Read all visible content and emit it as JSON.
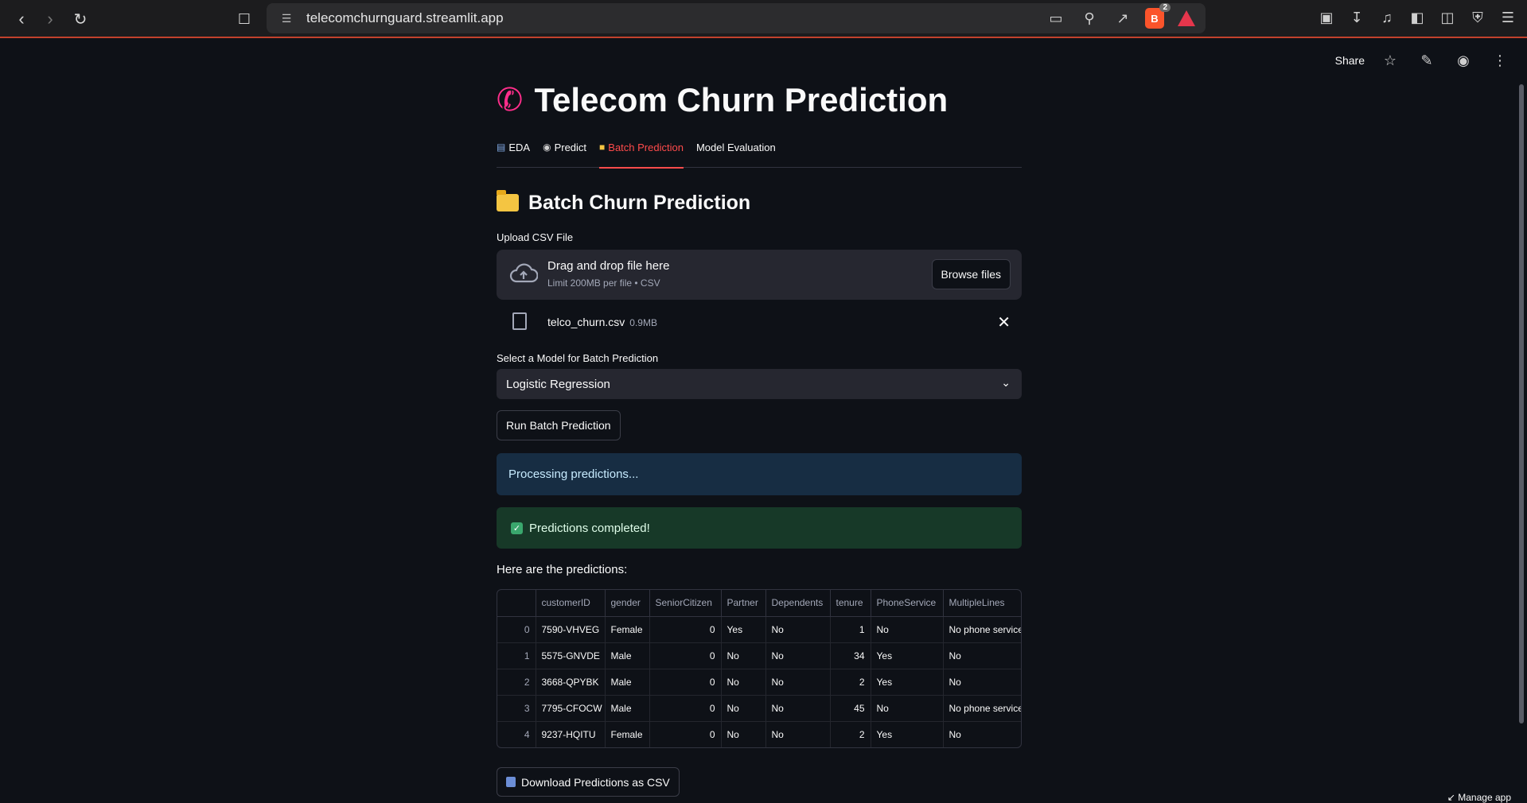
{
  "browser": {
    "url": "telecomchurnguard.streamlit.app",
    "brave_badge": "2"
  },
  "toolbar": {
    "share_label": "Share"
  },
  "app": {
    "title": "Telecom Churn Prediction",
    "tabs": [
      {
        "label": "EDA",
        "icon": "chart-icon"
      },
      {
        "label": "Predict",
        "icon": "eye-icon"
      },
      {
        "label": "Batch Prediction",
        "icon": "folder-icon"
      },
      {
        "label": "Model Evaluation",
        "icon": ""
      }
    ]
  },
  "batch": {
    "heading": "Batch Churn Prediction",
    "upload_label": "Upload CSV File",
    "dropzone_main": "Drag and drop file here",
    "dropzone_sub": "Limit 200MB per file • CSV",
    "browse_label": "Browse files",
    "file_name": "telco_churn.csv",
    "file_size": "0.9MB",
    "model_label": "Select a Model for Batch Prediction",
    "model_value": "Logistic Regression",
    "run_label": "Run Batch Prediction",
    "info_text": "Processing predictions...",
    "success_text": "Predictions completed!",
    "results_text": "Here are the predictions:",
    "download_label": "Download Predictions as CSV",
    "manage_label": "Manage app"
  },
  "table": {
    "columns": [
      "",
      "customerID",
      "gender",
      "SeniorCitizen",
      "Partner",
      "Dependents",
      "tenure",
      "PhoneService",
      "MultipleLines"
    ],
    "rows": [
      [
        "0",
        "7590-VHVEG",
        "Female",
        "0",
        "Yes",
        "No",
        "1",
        "No",
        "No phone service"
      ],
      [
        "1",
        "5575-GNVDE",
        "Male",
        "0",
        "No",
        "No",
        "34",
        "Yes",
        "No"
      ],
      [
        "2",
        "3668-QPYBK",
        "Male",
        "0",
        "No",
        "No",
        "2",
        "Yes",
        "No"
      ],
      [
        "3",
        "7795-CFOCW",
        "Male",
        "0",
        "No",
        "No",
        "45",
        "No",
        "No phone service"
      ],
      [
        "4",
        "9237-HQITU",
        "Female",
        "0",
        "No",
        "No",
        "2",
        "Yes",
        "No"
      ]
    ]
  },
  "colors": {
    "accent": "#ff4b4b",
    "background": "#0e1117",
    "info_bg": "#172d43",
    "success_bg": "#173928"
  }
}
